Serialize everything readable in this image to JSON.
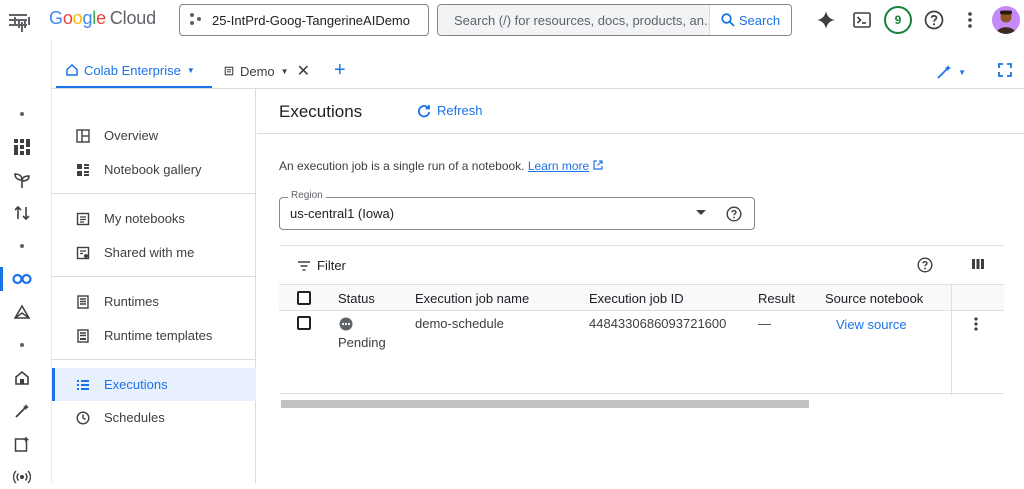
{
  "topbar": {
    "brand": {
      "g": "G",
      "o1": "o",
      "o2": "o",
      "g2": "g",
      "l": "l",
      "e": "e",
      "cloud": "Cloud"
    },
    "project_name": "25-IntPrd-Goog-TangerineAIDemo",
    "search_placeholder": "Search (/) for resources, docs, products, an...",
    "search_button": "Search",
    "notification_count": "9"
  },
  "tabs": {
    "active_label": "Colab Enterprise",
    "demo_label": "Demo",
    "add_label": "+"
  },
  "nav": {
    "items": [
      {
        "label": "Overview",
        "icon": "overview-icon"
      },
      {
        "label": "Notebook gallery",
        "icon": "gallery-icon"
      },
      {
        "label": "My notebooks",
        "icon": "notebook-icon"
      },
      {
        "label": "Shared with me",
        "icon": "shared-icon"
      },
      {
        "label": "Runtimes",
        "icon": "runtime-icon"
      },
      {
        "label": "Runtime templates",
        "icon": "template-icon"
      },
      {
        "label": "Executions",
        "icon": "list-icon"
      },
      {
        "label": "Schedules",
        "icon": "clock-icon"
      }
    ],
    "active": "Executions"
  },
  "page": {
    "title": "Executions",
    "refresh_label": "Refresh",
    "description": "An execution job is a single run of a notebook.",
    "learn_more": "Learn more",
    "region_label": "Region",
    "region_value": "us-central1 (Iowa)"
  },
  "table": {
    "filter_label": "Filter",
    "columns": [
      "Status",
      "Execution job name",
      "Execution job ID",
      "Result",
      "Source notebook"
    ],
    "rows": [
      {
        "status": "Pending",
        "name": "demo-schedule",
        "id": "4484330686093721600",
        "result": "—",
        "source": "View source"
      }
    ]
  },
  "colors": {
    "accent": "#1a73e8",
    "active_bg": "#e8f0fe",
    "badge_green": "#188038"
  }
}
